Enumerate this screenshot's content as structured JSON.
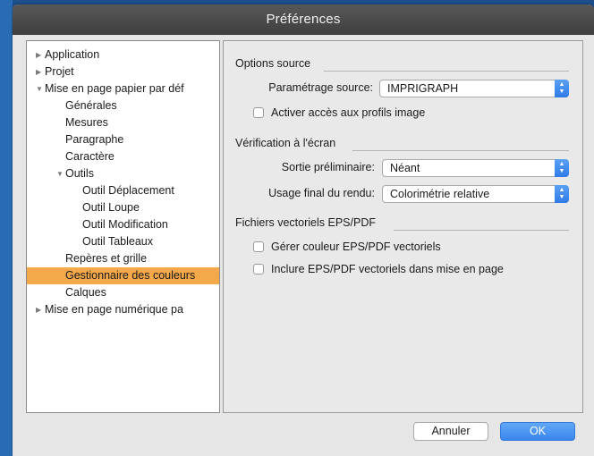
{
  "window": {
    "title": "Préférences"
  },
  "tree": {
    "items": [
      {
        "label": "Application",
        "arrow": "▶"
      },
      {
        "label": "Projet",
        "arrow": "▶"
      },
      {
        "label": "Mise en page papier par déf",
        "arrow": "▼"
      },
      {
        "label": "Générales",
        "arrow": ""
      },
      {
        "label": "Mesures",
        "arrow": ""
      },
      {
        "label": "Paragraphe",
        "arrow": ""
      },
      {
        "label": "Caractère",
        "arrow": ""
      },
      {
        "label": "Outils",
        "arrow": "▼"
      },
      {
        "label": "Outil Déplacement",
        "arrow": ""
      },
      {
        "label": "Outil Loupe",
        "arrow": ""
      },
      {
        "label": "Outil Modification",
        "arrow": ""
      },
      {
        "label": "Outil Tableaux",
        "arrow": ""
      },
      {
        "label": "Repères et grille",
        "arrow": ""
      },
      {
        "label": "Gestionnaire des couleurs",
        "arrow": ""
      },
      {
        "label": "Calques",
        "arrow": ""
      },
      {
        "label": "Mise en page numérique pa",
        "arrow": "▶"
      }
    ]
  },
  "source": {
    "title": "Options source",
    "setting_label": "Paramétrage source:",
    "setting_value": "IMPRIGRAPH",
    "profiles_label": "Activer accès aux profils image"
  },
  "screen": {
    "title": "Vérification à l'écran",
    "output_label": "Sortie préliminaire:",
    "output_value": "Néant",
    "usage_label": "Usage final du rendu:",
    "usage_value": "Colorimétrie relative"
  },
  "vector": {
    "title": "Fichiers vectoriels EPS/PDF",
    "manage_label": "Gérer couleur EPS/PDF vectoriels",
    "include_label": "Inclure EPS/PDF vectoriels dans mise en page"
  },
  "buttons": {
    "cancel": "Annuler",
    "ok": "OK"
  },
  "colors": {
    "selection": "#f3a84a",
    "accent": "#3a86ee"
  }
}
